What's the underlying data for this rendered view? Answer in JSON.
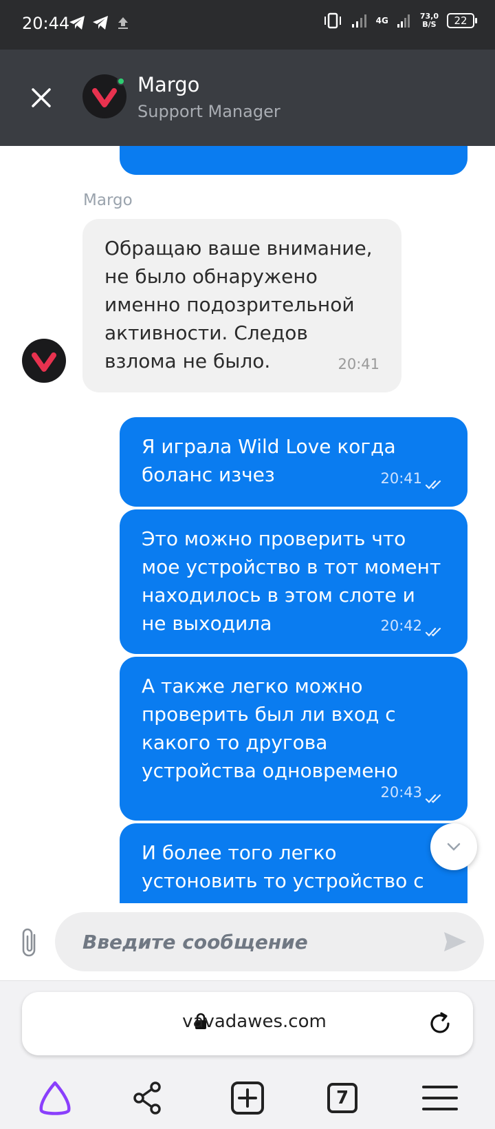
{
  "status_bar": {
    "time": "20:44",
    "network_speed_value": "73,0",
    "network_speed_unit": "B/S",
    "network_type": "4G",
    "battery": "22"
  },
  "header": {
    "name": "Margo",
    "role": "Support Manager"
  },
  "messages": [
    {
      "direction": "incoming",
      "sender": "Margo",
      "text": "Обращаю ваше внимание, не было обнаружено именно подозрительной активности. Следов взлома не было.",
      "time": "20:41"
    },
    {
      "direction": "outgoing",
      "text": "Я играла Wild Love когда боланс изчез",
      "time": "20:41",
      "status": "read"
    },
    {
      "direction": "outgoing",
      "text": "Это можно проверить что мое устройство в тот момент находилось в этом слоте и не выходила",
      "time": "20:42",
      "status": "read"
    },
    {
      "direction": "outgoing",
      "text": "А также легко можно проверить был ли вход с какого то другова устройства одновремено",
      "time": "20:43",
      "status": "read"
    },
    {
      "direction": "outgoing",
      "text": "И более того легко устоновить то устройство с",
      "time": "",
      "status": "read"
    }
  ],
  "composer": {
    "placeholder": "Введите сообщение"
  },
  "browser": {
    "url": "vavadawes.com",
    "tabs_count": "7"
  },
  "colors": {
    "outgoing_bubble": "#0a7cf0",
    "incoming_bubble": "#f1f1f1",
    "header_bg": "#3a3d42",
    "brand_red": "#e8324f",
    "online": "#2ecc71"
  }
}
